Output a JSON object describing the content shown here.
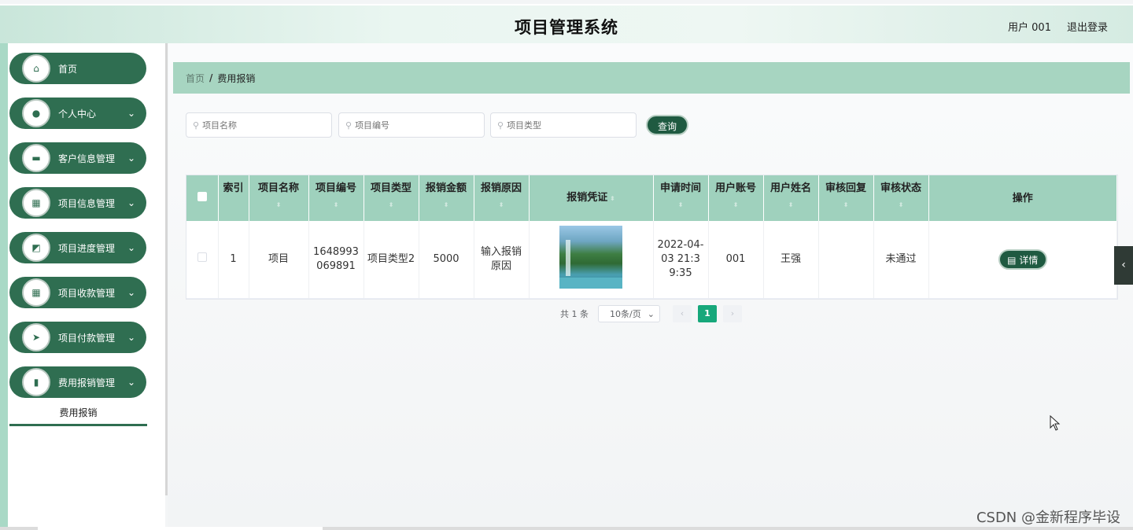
{
  "header": {
    "title": "项目管理系统",
    "user_label": "用户 001",
    "logout_label": "退出登录"
  },
  "sidebar": {
    "items": [
      {
        "label": "首页",
        "icon": "home-icon",
        "arrow": ""
      },
      {
        "label": "个人中心",
        "icon": "user-icon",
        "arrow": "⌄"
      },
      {
        "label": "客户信息管理",
        "icon": "monitor-icon",
        "arrow": "⌄"
      },
      {
        "label": "项目信息管理",
        "icon": "grid-icon",
        "arrow": "⌄"
      },
      {
        "label": "项目进度管理",
        "icon": "chart-icon",
        "arrow": "⌄"
      },
      {
        "label": "项目收款管理",
        "icon": "grid-icon",
        "arrow": "⌄"
      },
      {
        "label": "项目付款管理",
        "icon": "send-icon",
        "arrow": "⌄"
      },
      {
        "label": "费用报销管理",
        "icon": "bar-chart-icon",
        "arrow": "⌄"
      }
    ],
    "submenu_active": "费用报销"
  },
  "breadcrumb": {
    "home": "首页",
    "separator": "/",
    "current": "费用报销"
  },
  "search": {
    "name_placeholder": "项目名称",
    "code_placeholder": "项目编号",
    "type_placeholder": "项目类型",
    "query_label": "查询"
  },
  "table": {
    "headers": [
      "索引",
      "项目名称",
      "项目编号",
      "项目类型",
      "报销金额",
      "报销原因",
      "报销凭证",
      "申请时间",
      "用户账号",
      "用户姓名",
      "审核回复",
      "审核状态",
      "操作"
    ],
    "rows": [
      {
        "index": "1",
        "project_name": "项目",
        "project_code": "1648993069891",
        "project_type": "项目类型2",
        "amount": "5000",
        "reason": "输入报销原因",
        "apply_time": "2022-04-03 21:39:35",
        "user_account": "001",
        "user_name": "王强",
        "review_reply": "",
        "review_status": "未通过",
        "action_label": "详情"
      }
    ]
  },
  "pagination": {
    "total": "共 1 条",
    "page_size": "10条/页",
    "current_page": "1",
    "prev": "‹",
    "next": "›"
  },
  "side_tab": "‹",
  "watermark": "CSDN @金新程序毕设"
}
